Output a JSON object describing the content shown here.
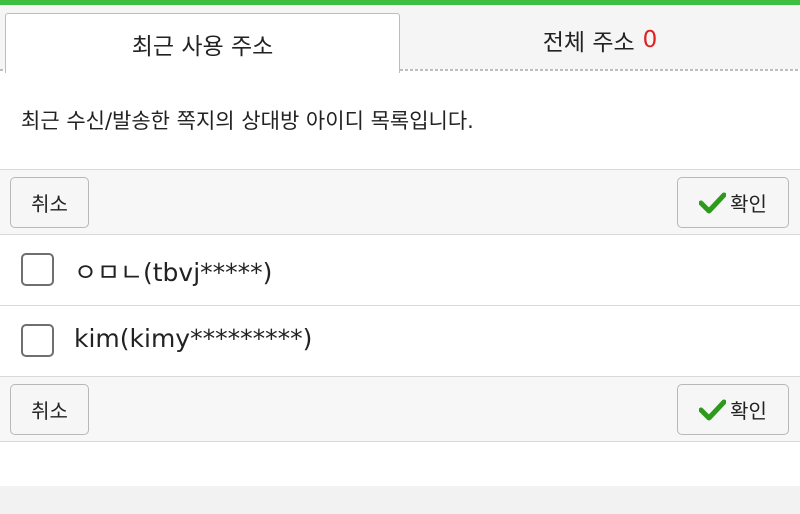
{
  "tabs": {
    "recent_label": "최근 사용 주소",
    "all_label": "전체 주소",
    "all_count": "0"
  },
  "description": "최근 수신/발송한 쪽지의 상대방 아이디 목록입니다.",
  "buttons": {
    "cancel_label": "취소",
    "ok_label": "확인"
  },
  "contacts": [
    {
      "label": "ㅇㅁㄴ(tbvj*****)",
      "checked": false
    },
    {
      "label": "kim(kimy*********)",
      "checked": false
    }
  ],
  "colors": {
    "accent_green": "#3fbf3f",
    "check_green": "#2e9a1c",
    "count_red": "#e02020"
  }
}
